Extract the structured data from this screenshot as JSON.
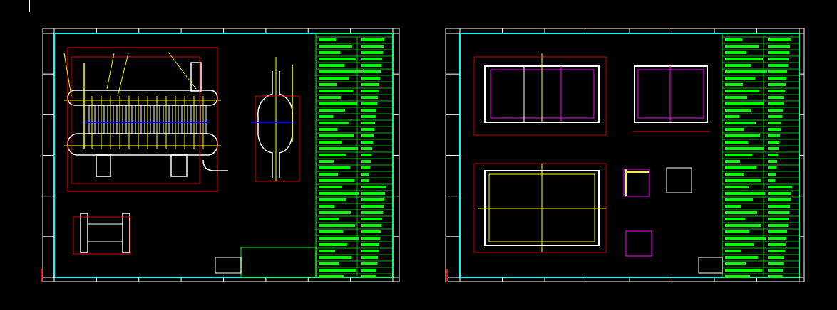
{
  "sheets": [
    {
      "kind": "vessel"
    },
    {
      "kind": "frame"
    }
  ]
}
